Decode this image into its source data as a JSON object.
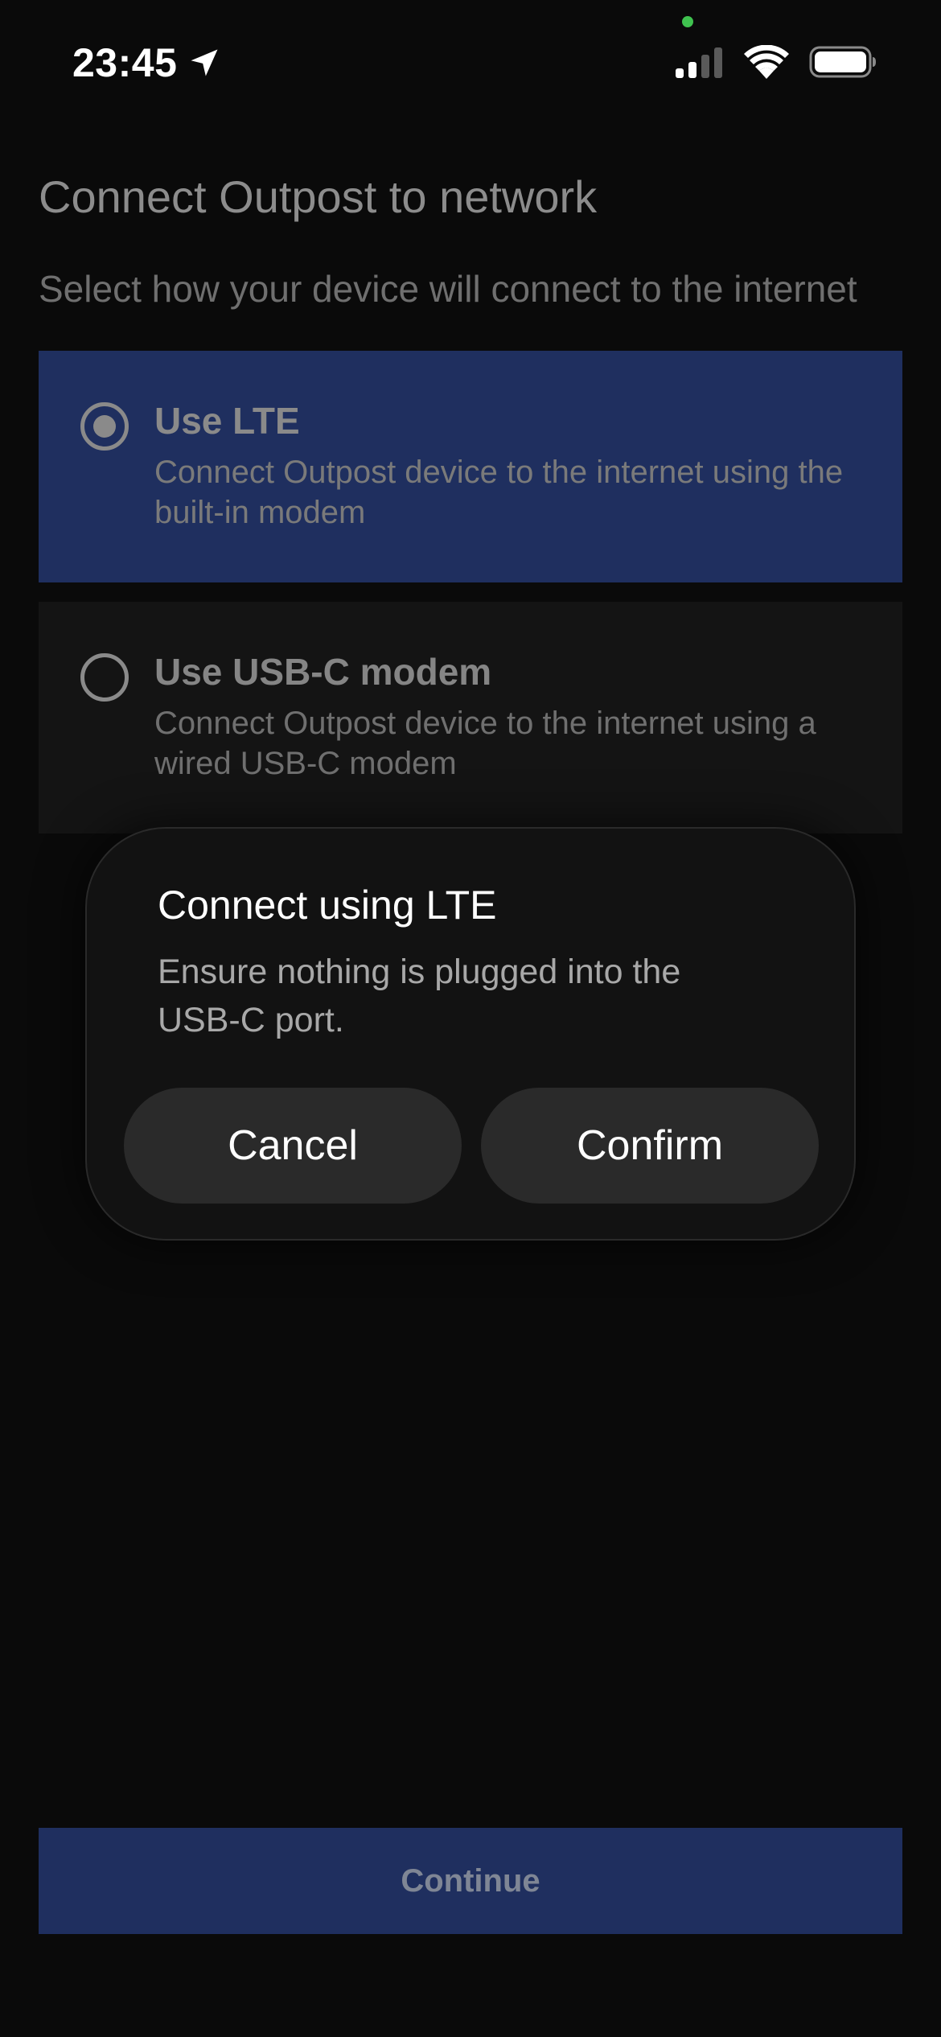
{
  "status_bar": {
    "time": "23:45",
    "icons": [
      "location-arrow-icon",
      "cellular-signal-icon",
      "wifi-icon",
      "battery-icon"
    ],
    "privacy_indicator_color": "#3fc24f"
  },
  "page": {
    "title": "Connect Outpost to network",
    "subtitle": "Select how your device will connect to the internet"
  },
  "options": [
    {
      "title": "Use LTE",
      "description": "Connect Outpost device to the internet using the built-in modem",
      "selected": true
    },
    {
      "title": "Use USB-C modem",
      "description": "Connect Outpost device to the internet using a wired USB-C modem",
      "selected": false
    }
  ],
  "dialog": {
    "title": "Connect using LTE",
    "message": "Ensure nothing is plugged into the USB-C port.",
    "cancel_label": "Cancel",
    "confirm_label": "Confirm"
  },
  "footer": {
    "continue_label": "Continue"
  },
  "colors": {
    "background": "#0a0a0a",
    "selected_card": "#1f2f5f",
    "unselected_card": "#141414",
    "dialog_background": "#121212",
    "dialog_button": "#2a2a2a"
  }
}
